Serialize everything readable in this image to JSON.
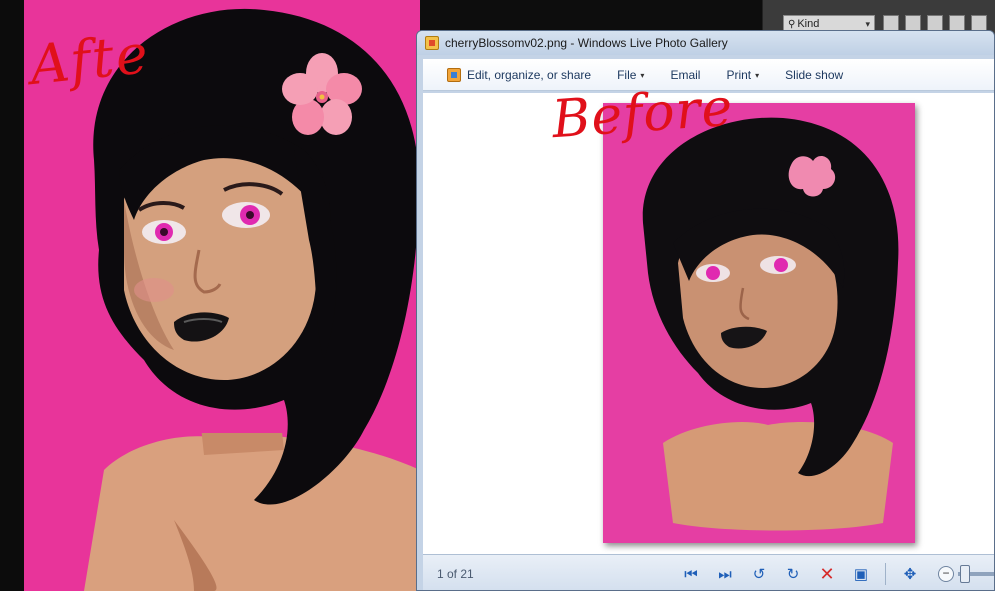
{
  "annotations": {
    "after": "Afte",
    "before": "Before"
  },
  "photoshop": {
    "kind_label": "Kind"
  },
  "window": {
    "title": "cherryBlossomv02.png - Windows Live Photo Gallery"
  },
  "toolbar": {
    "edit_label": "Edit, organize, or share",
    "file_label": "File",
    "email_label": "Email",
    "print_label": "Print",
    "slideshow_label": "Slide show"
  },
  "status": {
    "count": "1 of 21"
  },
  "icons": {
    "first": "first-image-icon",
    "next": "next-image-icon",
    "rotate_left": "rotate-left-icon",
    "rotate_right": "rotate-right-icon",
    "delete": "delete-icon",
    "slideshow": "slideshow-icon",
    "actual_size": "actual-size-icon"
  },
  "colors": {
    "canvas_pink": "#e8349a",
    "annotation_red": "#e0101a"
  }
}
